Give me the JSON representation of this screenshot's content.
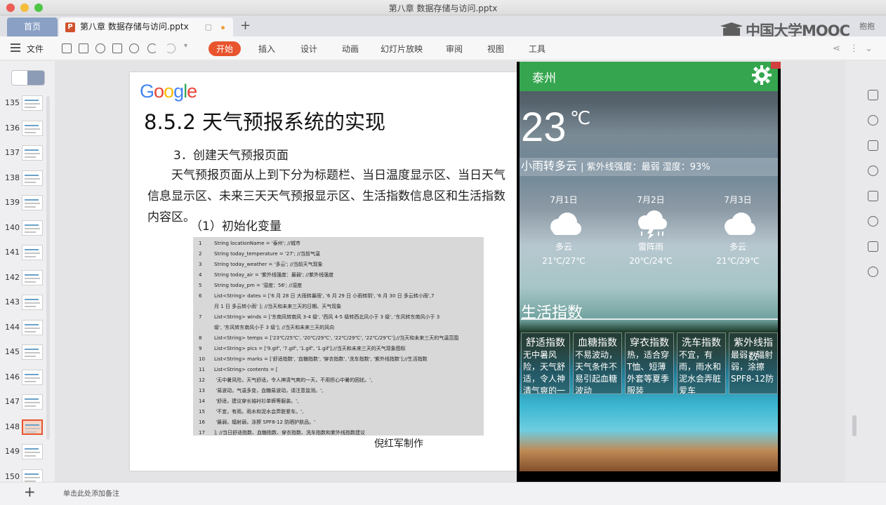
{
  "window": {
    "title": "第八章 数据存储与访问.pptx"
  },
  "tabs": {
    "home": "首页",
    "doc": "第八章 数据存储与访问.pptx",
    "add": "+"
  },
  "branding": {
    "logo": "中国大学MOOC",
    "user": "抱抱"
  },
  "ribbon": {
    "file": "文件",
    "tabs": [
      "开始",
      "插入",
      "设计",
      "动画",
      "幻灯片放映",
      "审阅",
      "视图",
      "工具"
    ]
  },
  "slides_panel": {
    "numbers": [
      "135",
      "136",
      "137",
      "138",
      "139",
      "140",
      "141",
      "142",
      "143",
      "144",
      "145",
      "146",
      "147",
      "148",
      "149",
      "150"
    ],
    "active": "148"
  },
  "slide": {
    "logo": "Google",
    "title": "8.5.2 天气预报系统的实现",
    "subtitle": "3．创建天气预报页面",
    "paragraph": "天气预报页面从上到下分为标题栏、当日温度显示区、当日天气信息显示区、未来三天天气预报显示区、生活指数信息区和生活指数内容区。",
    "section": "（1）初始化变量",
    "code": [
      {
        "n": "1",
        "t": "String locationName = '泰州';                //城市"
      },
      {
        "n": "2",
        "t": "String today_temperature = '27';              //当前气温"
      },
      {
        "n": "3",
        "t": "String today_weather = '多云';               //当前天气现象"
      },
      {
        "n": "4",
        "t": "String today_air = '紫外线强度：最弱'; //紫外线强度"
      },
      {
        "n": "5",
        "t": "String today_pm = '湿度：56';                //湿度"
      },
      {
        "n": "6",
        "t": "List<String> dates = ['6 月 28 日  大雨转暴雨', '6 月 29 日  小雨转阴', '6 月 30 日  多云转小雨',7"
      },
      {
        "n": "",
        "t": "月 1 日  多云转小雨'  ];                            //当天和未来三天的日期、天气现象"
      },
      {
        "n": "7",
        "t": "List<String> winds = ['东南风转南风 3-4 级', '西风 4-5 级转西北风小于 3 级', '东风转东南风小于 3"
      },
      {
        "n": "",
        "t": "级', '东风转东南风小于 3 级'];                        //当天和未来三天的风向"
      },
      {
        "n": "8",
        "t": "List<String> temps = ['23℃/25℃', '20℃/29℃', '22℃/29℃', '22℃/29℃'];//当天和未来三天的气温范围"
      },
      {
        "n": "9",
        "t": "List<String> pics = ['9.gif', '7.gif', '1.gif', '1.gif'];//当天和未来三天的天气现象图标"
      },
      {
        "n": "10",
        "t": "List<String> marks = ['舒适指数', '血糖指数', '穿衣指数', '洗车指数', '紫外线指数'];//生活指数"
      },
      {
        "n": "11",
        "t": "List<String> contents = ["
      },
      {
        "n": "12",
        "t": "    '无中暑风险，天气舒适，令人神清气爽的一天，不用担心中暑的困扰。',"
      },
      {
        "n": "13",
        "t": "    '易波动，气温多变，血糖易波动，请注意监测。',"
      },
      {
        "n": "14",
        "t": "    '舒适，建议穿长袖衬衫单裤等服装。',"
      },
      {
        "n": "15",
        "t": "    '不宜，有雨，雨水和泥水会弄脏爱车。',"
      },
      {
        "n": "16",
        "t": "    '最弱，辐射弱，涂擦 SPF8-12 防晒护肤品。'"
      },
      {
        "n": "17",
        "t": "];   //当日舒适指数、血糖指数、穿衣指数、洗车指数和紫外线指数建议"
      }
    ],
    "author": "倪红军制作"
  },
  "phone": {
    "city": "泰州",
    "temperature": "23",
    "unit": "℃",
    "weather": "小雨转多云",
    "detail": "| 紫外线强度：最弱 湿度：93%",
    "forecast": [
      {
        "date": "7月1日",
        "icon": "cloud-icon",
        "cond": "多云",
        "range": "21℃/27℃"
      },
      {
        "date": "7月2日",
        "icon": "thunder-shower-icon",
        "cond": "雷阵雨",
        "range": "20℃/24℃"
      },
      {
        "date": "7月3日",
        "icon": "cloud-icon",
        "cond": "多云",
        "range": "21℃/29℃"
      }
    ],
    "life_title": "生活指数",
    "life": [
      {
        "h": "舒适指数",
        "b": "无中暑风险，天气舒适，令人神清气爽的一"
      },
      {
        "h": "血糖指数",
        "b": "不易波动，天气条件不易引起血糖波动"
      },
      {
        "h": "穿衣指数",
        "b": "热，适合穿T恤、短薄外套等夏季服装"
      },
      {
        "h": "洗车指数",
        "b": "不宜，有雨，雨水和泥水会弄脏爱车"
      },
      {
        "h": "紫外线指数",
        "b": "最弱，辐射弱，涂擦SPF8-12防"
      }
    ]
  },
  "bottom": {
    "add": "+",
    "notes": "单击此处添加备注"
  },
  "colors": {
    "accent": "#e8542d",
    "appbar": "#35a64f",
    "hometab": "#8aa0c4"
  }
}
